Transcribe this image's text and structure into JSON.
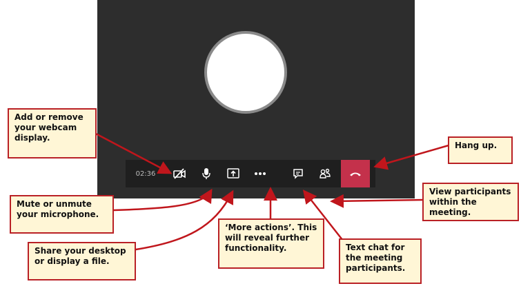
{
  "call": {
    "timer": "02:36"
  },
  "controls": [
    {
      "key": "camera",
      "icon": "camera-off-icon"
    },
    {
      "key": "mic",
      "icon": "microphone-icon"
    },
    {
      "key": "share",
      "icon": "share-screen-icon"
    },
    {
      "key": "more",
      "icon": "more-dots-icon"
    },
    {
      "key": "chat",
      "icon": "chat-icon"
    },
    {
      "key": "participants",
      "icon": "participants-icon"
    },
    {
      "key": "hangup",
      "icon": "hang-up-icon"
    }
  ],
  "callouts": {
    "webcam": "Add or remove your webcam display.",
    "mute": "Mute or unmute your microphone.",
    "share": "Share your desktop or display a file.",
    "more": "‘More actions’. This will reveal further functionality.",
    "chat": "Text chat for the meeting participants.",
    "participants": "View participants within the meeting.",
    "hangup": "Hang up."
  },
  "colors": {
    "stage": "#2d2d2d",
    "toolbar": "#1f1f1f",
    "hangup": "#c4314b",
    "callout_border": "#b92025",
    "callout_fill": "#fff6d6",
    "arrow": "#c0161c"
  }
}
